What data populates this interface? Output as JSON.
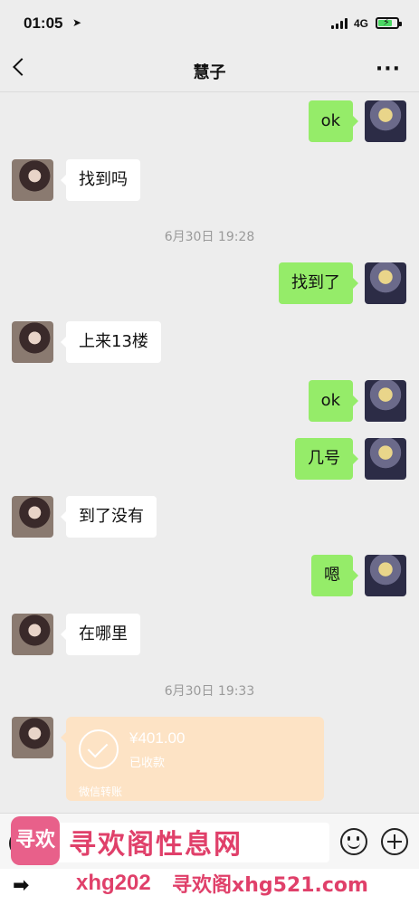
{
  "status_bar": {
    "time": "01:05",
    "network": "4G"
  },
  "nav": {
    "title": "慧子"
  },
  "messages": {
    "m1": {
      "text": "ok"
    },
    "m2": {
      "text": "找到吗"
    },
    "ts1": "6月30日 19:28",
    "m3": {
      "text": "找到了"
    },
    "m4": {
      "text": "上来13楼"
    },
    "m5": {
      "text": "ok"
    },
    "m6": {
      "text": "几号"
    },
    "m7": {
      "text": "到了没有"
    },
    "m8": {
      "text": "嗯"
    },
    "m9": {
      "text": "在哪里"
    },
    "ts2": "6月30日 19:33"
  },
  "transfer": {
    "amount": "¥401.00",
    "status": "已收款",
    "label": "微信转账"
  },
  "input": {
    "placeholder": ""
  },
  "watermark": {
    "logo_text": "寻欢",
    "title": "寻欢阁性息网",
    "url_a": "xhg202",
    "url_b": "寻欢阁xhg521.com"
  }
}
